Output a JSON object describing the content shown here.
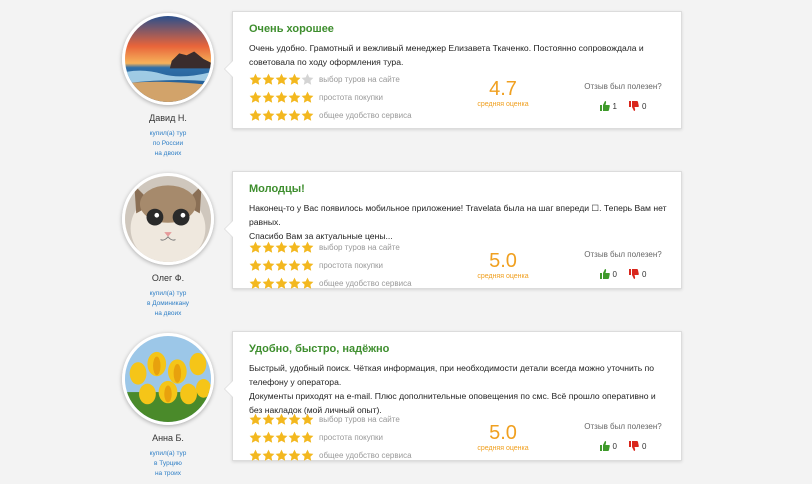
{
  "reviews": [
    {
      "author": {
        "name": "Давид Н.",
        "meta": [
          "купил(а) тур",
          "по России",
          "на двоих"
        ]
      },
      "avatar_icon": "sunset-beach-photo",
      "title": "Очень хорошее",
      "text": [
        "Очень удобно. Грамотный и вежливый менеджер Елизавета Ткаченко. Постоянно сопровождала и советовала по ходу оформления тура."
      ],
      "ratings": [
        {
          "label": "выбор туров на сайте",
          "stars": 4
        },
        {
          "label": "простота покупки",
          "stars": 5
        },
        {
          "label": "общее удобство сервиса",
          "stars": 5
        }
      ],
      "score": "4.7",
      "score_label": "средняя оценка",
      "helpful_question": "Отзыв был полезен?",
      "likes": "1",
      "dislikes": "0"
    },
    {
      "author": {
        "name": "Олег Ф.",
        "meta": [
          "купил(а) тур",
          "в Доминикану",
          "на двоих"
        ]
      },
      "avatar_icon": "kitten-photo",
      "title": "Молодцы!",
      "text": [
        "Наконец-то у Вас появилось мобильное приложение! Travelata была на шаг впереди ☐. Теперь Вам нет равных.",
        "Спасибо Вам за актуальные цены..."
      ],
      "ratings": [
        {
          "label": "выбор туров на сайте",
          "stars": 5
        },
        {
          "label": "простота покупки",
          "stars": 5
        },
        {
          "label": "общее удобство сервиса",
          "stars": 5
        }
      ],
      "score": "5.0",
      "score_label": "средняя оценка",
      "helpful_question": "Отзыв был полезен?",
      "likes": "0",
      "dislikes": "0"
    },
    {
      "author": {
        "name": "Анна Б.",
        "meta": [
          "купил(а) тур",
          "в Турцию",
          "на троих"
        ]
      },
      "avatar_icon": "tulips-photo",
      "title": "Удобно, быстро, надёжно",
      "text": [
        "Быстрый, удобный поиск. Чёткая информация, при необходимости детали всегда можно уточнить по телефону у оператора.",
        "Документы приходят на e-mail. Плюс дополнительные оповещения по смс. Всё прошло оперативно и без накладок (мой личный опыт)."
      ],
      "ratings": [
        {
          "label": "выбор туров на сайте",
          "stars": 5
        },
        {
          "label": "простота покупки",
          "stars": 5
        },
        {
          "label": "общее удобство сервиса",
          "stars": 5
        }
      ],
      "score": "5.0",
      "score_label": "средняя оценка",
      "helpful_question": "Отзыв был полезен?",
      "likes": "0",
      "dislikes": "0"
    }
  ],
  "colors": {
    "title": "#3e8e2e",
    "score": "#f0a020",
    "star": "#f3b81f",
    "star_empty": "#d4d4d4",
    "like": "#3e9a2a",
    "dislike": "#d9261c",
    "link": "#2f7fc6"
  },
  "icons": {
    "star": "star-icon",
    "like": "thumbs-up-icon",
    "dislike": "thumbs-down-icon"
  }
}
